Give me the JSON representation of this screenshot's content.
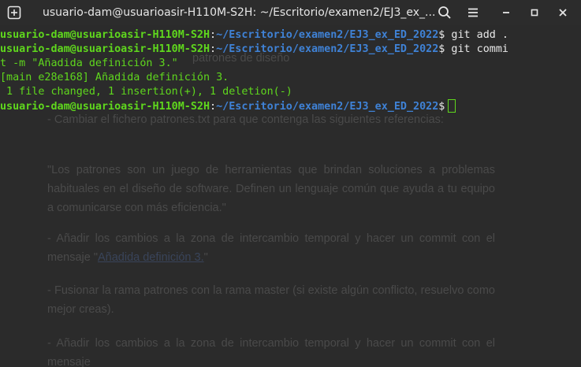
{
  "window": {
    "title": "usuario-dam@usuarioasir-H110M-S2H: ~/Escritorio/examen2/EJ3_ex_..."
  },
  "icons": [
    "new-tab-icon",
    "search-icon",
    "menu-icon",
    "minimize-icon",
    "maximize-icon",
    "close-icon"
  ],
  "terminal": {
    "prompt_user": "usuario-dam@usuarioasir-H110M-S2H",
    "prompt_path": "~/Escritorio/examen2/EJ3_ex_ED_2022",
    "line1_cmd": " git add .",
    "line2_cmd": " git commi",
    "line2b": "t -m \"Añadida definición 3.\"",
    "line3": "[main e28e168] Añadida definición 3.",
    "line4": " 1 file changed, 1 insertion(+), 1 deletion(-)",
    "colon": ":",
    "dollar": "$"
  },
  "background_document": {
    "fragment_top": "patrones de diseño",
    "p1": "- Cambiar el fichero patrones.txt para que contenga las siguientes referencias:",
    "p2": "\"Los patrones son un juego de herramientas que brindan soluciones a problemas habituales en el diseño de software. Definen un lenguaje común que ayuda a tu equipo a comunicarse con más eficiencia.\"",
    "p3_a": "- Añadir los cambios a la zona de intercambio temporal y hacer un commit con el mensaje \"",
    "p3_link": "Añadida definición 3.",
    "p3_b": "\"",
    "p4": "- Fusionar la rama patrones con la rama master (si existe algún conflicto, resuelvo como mejor creas).",
    "p5": "- Añadir los cambios a la zona de intercambio temporal y hacer un commit con el mensaje"
  },
  "colors": {
    "prompt_green": "#5fd71d",
    "path_blue": "#3f82d6",
    "terminal_bg": "#2b2b2b",
    "titlebar_bg": "#2c2c2c"
  }
}
